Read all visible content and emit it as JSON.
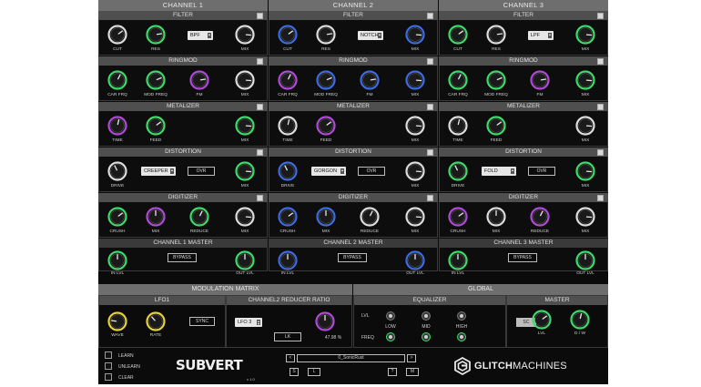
{
  "channels": [
    {
      "title": "CHANNEL 1",
      "filter": {
        "title": "FILTER",
        "mode": "BPF",
        "knobs": [
          {
            "label": "CUT",
            "color": "#dddddd",
            "v": 0.7
          },
          {
            "label": "RES",
            "color": "#3ddc6a",
            "v": 0.8
          },
          {
            "label": "MIX",
            "color": "#dddddd",
            "v": 0.85
          }
        ]
      },
      "ringmod": {
        "title": "RINGMOD",
        "knobs": [
          {
            "label": "CAR FRQ",
            "color": "#3ddc6a",
            "v": 0.6
          },
          {
            "label": "MOD FREQ",
            "color": "#3ddc6a",
            "v": 0.75
          },
          {
            "label": "FM",
            "color": "#b04ad8",
            "v": 0.8
          },
          {
            "label": "MIX",
            "color": "#dddddd",
            "v": 0.85
          }
        ]
      },
      "metalizer": {
        "title": "METALIZER",
        "knobs": [
          {
            "label": "TIME",
            "color": "#b04ad8",
            "v": 0.55
          },
          {
            "label": "FEED",
            "color": "#3ddc6a",
            "v": 0.7
          },
          {
            "label": "MIX",
            "color": "#3ddc6a",
            "v": 0.85
          }
        ]
      },
      "distortion": {
        "title": "DISTORTION",
        "mode": "CREEPER",
        "ovr": "OVR",
        "knobs": [
          {
            "label": "DRIVE",
            "color": "#dddddd",
            "v": 0.4
          },
          {
            "label": "MIX",
            "color": "#3ddc6a",
            "v": 0.85
          }
        ]
      },
      "digitizer": {
        "title": "DIGITIZER",
        "knobs": [
          {
            "label": "CRUSH",
            "color": "#3ddc6a",
            "v": 0.7
          },
          {
            "label": "MIX",
            "color": "#b04ad8",
            "v": 0.5
          },
          {
            "label": "REDUCE",
            "color": "#3ddc6a",
            "v": 0.6
          },
          {
            "label": "MIX",
            "color": "#dddddd",
            "v": 0.85
          }
        ]
      },
      "master": {
        "title": "CHANNEL 1 MASTER",
        "bypass": "BYPASS",
        "knobs": [
          {
            "label": "IN LVL",
            "color": "#3ddc6a",
            "v": 0.5
          },
          {
            "label": "OUT LVL",
            "color": "#3ddc6a",
            "v": 0.5
          }
        ]
      }
    },
    {
      "title": "CHANNEL 2",
      "filter": {
        "title": "FILTER",
        "mode": "NOTCH",
        "knobs": [
          {
            "label": "CUT",
            "color": "#3d6be0",
            "v": 0.7
          },
          {
            "label": "RES",
            "color": "#dddddd",
            "v": 0.8
          },
          {
            "label": "MIX",
            "color": "#3d6be0",
            "v": 0.85
          }
        ]
      },
      "ringmod": {
        "title": "RINGMOD",
        "knobs": [
          {
            "label": "CAR FRQ",
            "color": "#b04ad8",
            "v": 0.6
          },
          {
            "label": "MOD FREQ",
            "color": "#3d6be0",
            "v": 0.75
          },
          {
            "label": "FM",
            "color": "#3d6be0",
            "v": 0.8
          },
          {
            "label": "MIX",
            "color": "#3d6be0",
            "v": 0.85
          }
        ]
      },
      "metalizer": {
        "title": "METALIZER",
        "knobs": [
          {
            "label": "TIME",
            "color": "#dddddd",
            "v": 0.55
          },
          {
            "label": "FEED",
            "color": "#b04ad8",
            "v": 0.7
          },
          {
            "label": "MIX",
            "color": "#dddddd",
            "v": 0.85
          }
        ]
      },
      "distortion": {
        "title": "DISTORTION",
        "mode": "GORGON",
        "ovr": "OVR",
        "knobs": [
          {
            "label": "DRIVE",
            "color": "#3d6be0",
            "v": 0.4
          },
          {
            "label": "MIX",
            "color": "#dddddd",
            "v": 0.85
          }
        ]
      },
      "digitizer": {
        "title": "DIGITIZER",
        "knobs": [
          {
            "label": "CRUSH",
            "color": "#3d6be0",
            "v": 0.7
          },
          {
            "label": "MIX",
            "color": "#3d6be0",
            "v": 0.5
          },
          {
            "label": "REDUCE",
            "color": "#dddddd",
            "v": 0.6
          },
          {
            "label": "MIX",
            "color": "#dddddd",
            "v": 0.85
          }
        ]
      },
      "master": {
        "title": "CHANNEL 2 MASTER",
        "bypass": "BYPASS",
        "knobs": [
          {
            "label": "IN LVL",
            "color": "#3d6be0",
            "v": 0.5
          },
          {
            "label": "OUT LVL",
            "color": "#3d6be0",
            "v": 0.5
          }
        ]
      }
    },
    {
      "title": "CHANNEL 3",
      "filter": {
        "title": "FILTER",
        "mode": "LPF",
        "knobs": [
          {
            "label": "CUT",
            "color": "#3ddc6a",
            "v": 0.7
          },
          {
            "label": "RES",
            "color": "#dddddd",
            "v": 0.8
          },
          {
            "label": "MIX",
            "color": "#3ddc6a",
            "v": 0.85
          }
        ]
      },
      "ringmod": {
        "title": "RINGMOD",
        "knobs": [
          {
            "label": "CAR FRQ",
            "color": "#3ddc6a",
            "v": 0.6
          },
          {
            "label": "MOD FREQ",
            "color": "#3ddc6a",
            "v": 0.75
          },
          {
            "label": "FM",
            "color": "#b04ad8",
            "v": 0.8
          },
          {
            "label": "MIX",
            "color": "#3ddc6a",
            "v": 0.85
          }
        ]
      },
      "metalizer": {
        "title": "METALIZER",
        "knobs": [
          {
            "label": "TIME",
            "color": "#dddddd",
            "v": 0.55
          },
          {
            "label": "FEED",
            "color": "#3ddc6a",
            "v": 0.7
          },
          {
            "label": "MIX",
            "color": "#dddddd",
            "v": 0.85
          }
        ]
      },
      "distortion": {
        "title": "DISTORTION",
        "mode": "FOLD",
        "ovr": "OVR",
        "knobs": [
          {
            "label": "DRIVE",
            "color": "#3ddc6a",
            "v": 0.4
          },
          {
            "label": "MIX",
            "color": "#3ddc6a",
            "v": 0.85
          }
        ]
      },
      "digitizer": {
        "title": "DIGITIZER",
        "knobs": [
          {
            "label": "CRUSH",
            "color": "#b04ad8",
            "v": 0.7
          },
          {
            "label": "MIX",
            "color": "#dddddd",
            "v": 0.5
          },
          {
            "label": "REDUCE",
            "color": "#b04ad8",
            "v": 0.6
          },
          {
            "label": "MIX",
            "color": "#dddddd",
            "v": 0.85
          }
        ]
      },
      "master": {
        "title": "CHANNEL 3 MASTER",
        "bypass": "BYPASS",
        "knobs": [
          {
            "label": "IN LVL",
            "color": "#3ddc6a",
            "v": 0.5
          },
          {
            "label": "OUT LVL",
            "color": "#3ddc6a",
            "v": 0.5
          }
        ]
      }
    }
  ],
  "modulation": {
    "title": "MODULATION MATRIX",
    "lfo": {
      "title": "LFO1",
      "sync": "SYNC",
      "knobs": [
        {
          "label": "WAVE",
          "color": "#e8d23a",
          "v": 0.2
        },
        {
          "label": "RATE",
          "color": "#e8d23a",
          "v": 0.35
        }
      ]
    },
    "reducer": {
      "title": "CHANNEL2 REDUCER RATIO",
      "source": "LFO 3",
      "lk": "LK",
      "amount": "47.98 %",
      "knob": {
        "color": "#b04ad8",
        "v": 0.5
      }
    }
  },
  "global": {
    "title": "GLOBAL",
    "equalizer": {
      "title": "EQUALIZER",
      "row_lvl": "LVL",
      "row_freq": "FREQ",
      "bands": [
        "LOW",
        "MID",
        "HIGH"
      ]
    },
    "master": {
      "title": "MASTER",
      "sc": "SC",
      "knobs": [
        {
          "label": "LVL",
          "color": "#3ddc6a",
          "v": 0.7
        },
        {
          "label": "D / W",
          "color": "#3ddc6a",
          "v": 0.55
        }
      ]
    }
  },
  "footer": {
    "options": [
      "LEARN",
      "UNLEARN",
      "CLEAR"
    ],
    "logo": "SUBVERT",
    "version": "v 1.0",
    "preset": "0_SonicRust",
    "nav_prev": "<",
    "nav_next": ">",
    "btn_s": "S",
    "btn_l": "L",
    "btn_q": "?",
    "btn_m": "M",
    "brand": "GLITCHMACHINES",
    "brand_bold": "GLITCH",
    "brand_light": "MACHINES"
  }
}
